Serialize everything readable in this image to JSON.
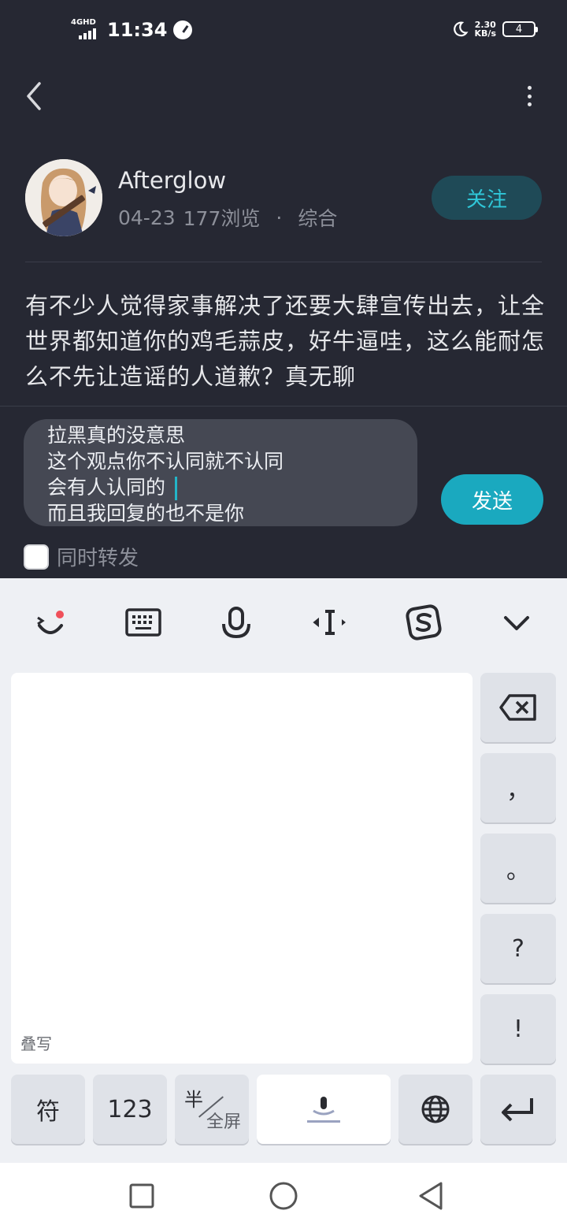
{
  "status_bar": {
    "network": "4GHD",
    "time": "11:34",
    "speed_value": "2.30",
    "speed_unit": "KB/s",
    "battery": "4"
  },
  "header": {
    "back_icon": "chevron-left-icon",
    "more_icon": "more-vertical-icon"
  },
  "post": {
    "author": "Afterglow",
    "date": "04-23",
    "views": "177浏览",
    "separator": "·",
    "category": "综合",
    "follow_label": "关注",
    "content": "有不少人觉得家事解决了还要大肆宣传出去，让全世界都知道你的鸡毛蒜皮，好牛逼哇，这么能耐怎么不先让造谣的人道歉？真无聊"
  },
  "composer": {
    "lines": [
      "拉黑真的没意思",
      "这个观点你不认同就不认同",
      "会有人认同的",
      "而且我回复的也不是你"
    ],
    "send_label": "发送",
    "repost_label": "同时转发",
    "repost_checked": false
  },
  "keyboard": {
    "handwrite_label": "叠写",
    "side_keys": [
      "，",
      "。",
      "?",
      "!"
    ],
    "symbol_key": "符",
    "number_key": "123",
    "half_label": "半",
    "full_label": "全屏",
    "toolbar_icons": [
      "emoji-icon",
      "keyboard-icon",
      "microphone-icon",
      "cursor-move-icon",
      "sogou-logo-icon",
      "collapse-down-icon"
    ]
  },
  "nav": {
    "icons": [
      "recent-apps-icon",
      "home-icon",
      "back-triangle-icon"
    ]
  },
  "colors": {
    "background": "#262833",
    "accent": "#1aa9bf",
    "follow_bg": "#1f4a57",
    "follow_text": "#2fc7d8"
  }
}
